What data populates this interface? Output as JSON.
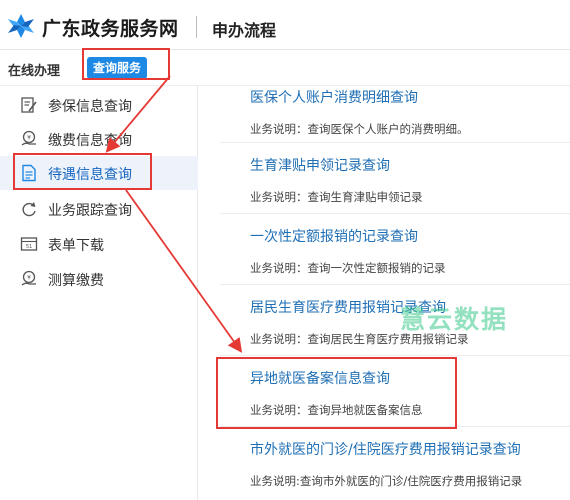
{
  "header": {
    "site_title": "广东政务服务网",
    "process_link": "申办流程"
  },
  "tabs": {
    "online": "在线办理",
    "query": "查询服务"
  },
  "sidebar": {
    "items": [
      {
        "label": "参保信息查询",
        "icon": "edit-doc-icon"
      },
      {
        "label": "缴费信息查询",
        "icon": "coin-hand-icon"
      },
      {
        "label": "待遇信息查询",
        "icon": "document-icon"
      },
      {
        "label": "业务跟踪查询",
        "icon": "refresh-icon"
      },
      {
        "label": "表单下载",
        "icon": "form-icon"
      },
      {
        "label": "测算缴费",
        "icon": "calculator-coin-icon"
      }
    ],
    "active_index": 2
  },
  "list": {
    "items": [
      {
        "title": "医保个人账户消费明细查询",
        "desc": "业务说明：查询医保个人账户的消费明细。"
      },
      {
        "title": "生育津贴申领记录查询",
        "desc": "业务说明：查询生育津贴申领记录"
      },
      {
        "title": "一次性定额报销的记录查询",
        "desc": "业务说明：查询一次性定额报销的记录"
      },
      {
        "title": "居民生育医疗费用报销记录查询",
        "desc": "业务说明：查询居民生育医疗费用报销记录"
      },
      {
        "title": "异地就医备案信息查询",
        "desc": "业务说明：查询异地就医备案信息"
      },
      {
        "title": "市外就医的门诊/住院医疗费用报销记录查询",
        "desc": "业务说明:查询市外就医的门诊/住院医疗费用报销记录"
      }
    ]
  },
  "watermark": "慧云数据",
  "colors": {
    "accent": "#1e88e5",
    "highlight": "#e53935",
    "link": "#1f6fb5"
  }
}
